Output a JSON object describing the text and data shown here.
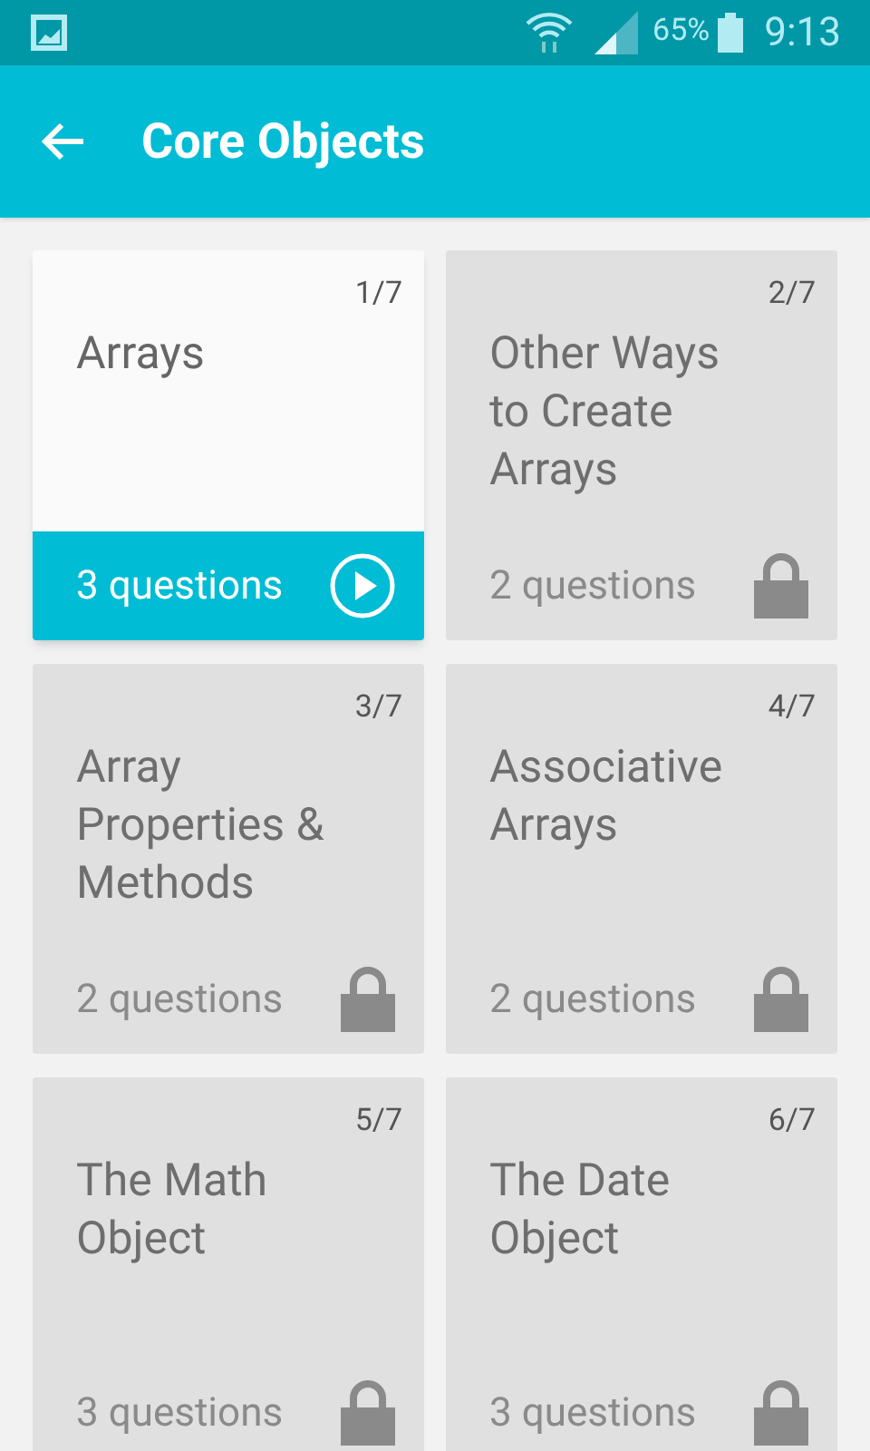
{
  "status_bar": {
    "battery": "65%",
    "time": "9:13"
  },
  "app_bar": {
    "title": "Core Objects"
  },
  "cards": [
    {
      "number": "1/7",
      "title": "Arrays",
      "questions": "3 questions",
      "locked": false
    },
    {
      "number": "2/7",
      "title": "Other Ways to Create Arrays",
      "questions": "2 questions",
      "locked": true
    },
    {
      "number": "3/7",
      "title": "Array Properties & Methods",
      "questions": "2 questions",
      "locked": true
    },
    {
      "number": "4/7",
      "title": "Associative Arrays",
      "questions": "2 questions",
      "locked": true
    },
    {
      "number": "5/7",
      "title": "The Math Object",
      "questions": "3 questions",
      "locked": true
    },
    {
      "number": "6/7",
      "title": "The Date Object",
      "questions": "3 questions",
      "locked": true
    }
  ]
}
